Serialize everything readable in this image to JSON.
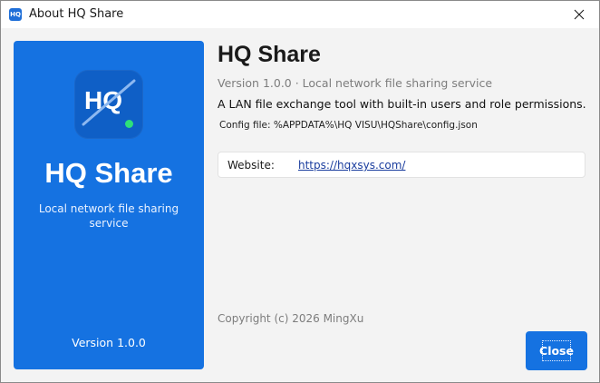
{
  "window": {
    "title": "About HQ Share",
    "app_icon_text": "HQ"
  },
  "brand": {
    "logo_text": "HQ",
    "name": "HQ Share",
    "subtitle": "Local network file sharing service",
    "version": "Version 1.0.0",
    "accent_color": "#1572e1",
    "dot_color": "#2ee07a"
  },
  "info": {
    "title": "HQ Share",
    "version_line": "Version 1.0.0 · Local network file sharing service",
    "description": "A LAN file exchange tool with built-in users and role permissions.",
    "config_file": "Config file: %APPDATA%\\HQ VISU\\HQShare\\config.json",
    "website_label": "Website:",
    "website_url": "https://hqxsys.com/",
    "copyright": "Copyright (c) 2026 MingXu"
  },
  "buttons": {
    "close_label": "Close"
  }
}
